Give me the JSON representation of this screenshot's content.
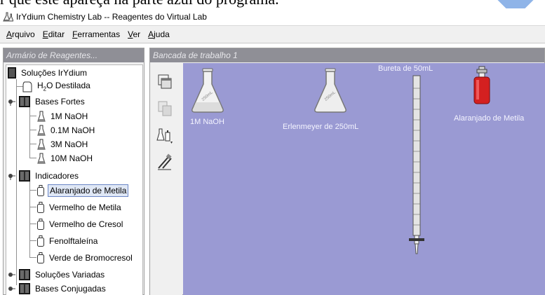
{
  "doc_fragment": "r que este apareça na parte azul do programa.",
  "window": {
    "title": "IrYdium Chemistry Lab -- Reagentes do Virtual Lab"
  },
  "menu": [
    {
      "label": "Arquivo",
      "mnemonic": "A",
      "rest": "rquivo"
    },
    {
      "label": "Editar",
      "mnemonic": "E",
      "rest": "ditar"
    },
    {
      "label": "Ferramentas",
      "mnemonic": "F",
      "rest": "erramentas"
    },
    {
      "label": "Ver",
      "mnemonic": "V",
      "rest": "er"
    },
    {
      "label": "Ajuda",
      "mnemonic": "A",
      "rest": "juda"
    }
  ],
  "left_panel": {
    "title": "Armário de Reagentes...",
    "tree": {
      "root": "Soluções IrYdium",
      "water_prefix": "H",
      "water_sub": "2",
      "water_suffix": "O Destilada",
      "strong_bases": "Bases Fortes",
      "bases": [
        "1M NaOH",
        "0.1M NaOH",
        "3M NaOH",
        "10M NaOH"
      ],
      "indicators": "Indicadores",
      "indicator_items": [
        "Alaranjado de Metila",
        "Vermelho de Metila",
        "Vermelho de Cresol",
        "Fenolftaleína",
        "Verde de Bromocresol"
      ],
      "selected": "Alaranjado de Metila",
      "misc_solutions": "Soluções Variadas",
      "conjugate_bases": "Bases Conjugadas"
    }
  },
  "bench": {
    "title": "Bancada de trabalho 1",
    "items": [
      {
        "label": "1M NaOH",
        "icon": "flask-with-solution-icon"
      },
      {
        "label": "Erlenmeyer de 250mL",
        "icon": "erlenmeyer-flask-icon"
      },
      {
        "label": "Bureta de 50mL",
        "icon": "burette-icon"
      },
      {
        "label": "Alaranjado de Metila",
        "icon": "indicator-bottle-icon"
      }
    ]
  },
  "colors": {
    "panel_header": "#8f8f96",
    "bench_background": "#9a9ad3",
    "indicator_bottle": "#d42020",
    "selection_border": "#6b86c5"
  }
}
